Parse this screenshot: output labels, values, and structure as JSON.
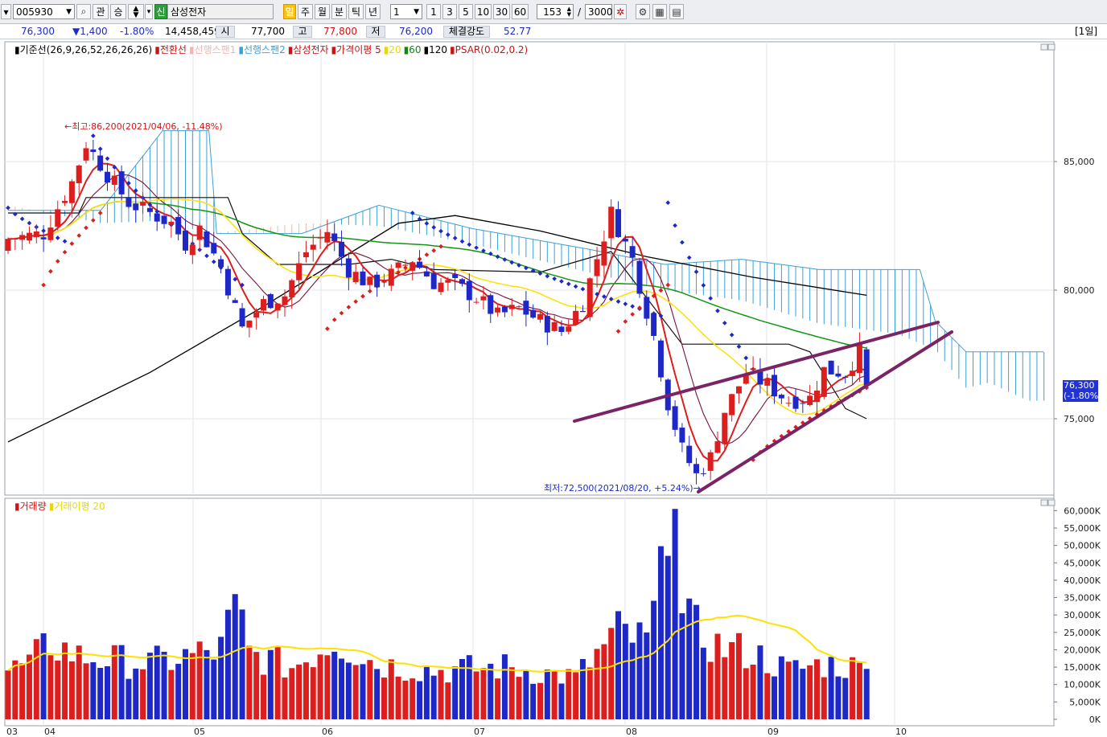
{
  "toolbar": {
    "code": "005930",
    "btn_gwan": "관",
    "btn_sang": "승",
    "shin_badge": "신",
    "stock_name": "삼성전자",
    "period_active": "일",
    "periods": [
      "주",
      "월",
      "분",
      "틱",
      "년"
    ],
    "interval_value": "1",
    "intervals": [
      "1",
      "3",
      "5",
      "10",
      "30",
      "60"
    ],
    "count_value": "153",
    "slash": "/",
    "total_value": "3000"
  },
  "quote": {
    "price": "76,300",
    "change": "▼1,400",
    "pct": "-1.80%",
    "volume": "14,458,459",
    "open_label": "시",
    "open": "77,700",
    "high_label": "고",
    "high": "77,800",
    "low_label": "저",
    "low": "76,200",
    "strength_label": "체결강도",
    "strength": "52.77",
    "timeframe": "[1일]"
  },
  "price_legend": [
    {
      "text": "기준선(26,9,26,52,26,26,26)",
      "color": "#000000"
    },
    {
      "text": "전환선",
      "color": "#c81414"
    },
    {
      "text": "선행스팬1",
      "color": "#f3b4b4"
    },
    {
      "text": "선행스팬2",
      "color": "#3aa0d8"
    },
    {
      "text": "삼성전자",
      "color": "#c81414"
    },
    {
      "text": "가격이평 5",
      "color": "#c81414"
    },
    {
      "text": "20",
      "color": "#e8d800"
    },
    {
      "text": "60",
      "color": "#118811"
    },
    {
      "text": "120",
      "color": "#000000"
    },
    {
      "text": "PSAR(0.02,0.2)",
      "color": "#c81414"
    }
  ],
  "volume_legend": [
    {
      "text": "거래량",
      "color": "#c81414"
    },
    {
      "text": "거래이평 20",
      "color": "#e8d800"
    }
  ],
  "annotations": {
    "high": "←최고:86,200(2021/04/06, -11.48%)",
    "low": "최저:72,500(2021/08/20, +5.24%)→"
  },
  "price_axis": [
    "85,000",
    "80,000",
    "75,000"
  ],
  "volume_axis": [
    "60,000K",
    "55,000K",
    "50,000K",
    "45,000K",
    "40,000K",
    "35,000K",
    "30,000K",
    "25,000K",
    "20,000K",
    "15,000K",
    "10,000K",
    "5,000K",
    "0K"
  ],
  "current_price_tag": [
    "76,300",
    "(-1.80%)"
  ],
  "months": [
    "03",
    "04",
    "05",
    "06",
    "07",
    "08",
    "09",
    "10"
  ],
  "colors": {
    "up": "#dc1e1e",
    "down": "#1e28c8",
    "ma5": "#dc1e1e",
    "ma20": "#ffe000",
    "ma60": "#129612",
    "ma120": "#000000",
    "ichimoku_cloud": "#3aa0d8",
    "trendline": "#7a2466",
    "psar_down": "#1e28c8",
    "psar_up": "#dc1e1e"
  },
  "chart_data": {
    "type": "candlestick",
    "price_ylim": [
      72000,
      86500
    ],
    "volume_ylim": [
      0,
      62000
    ],
    "volume_unit": "K",
    "candle_count": 121,
    "last_close": 76300
  }
}
